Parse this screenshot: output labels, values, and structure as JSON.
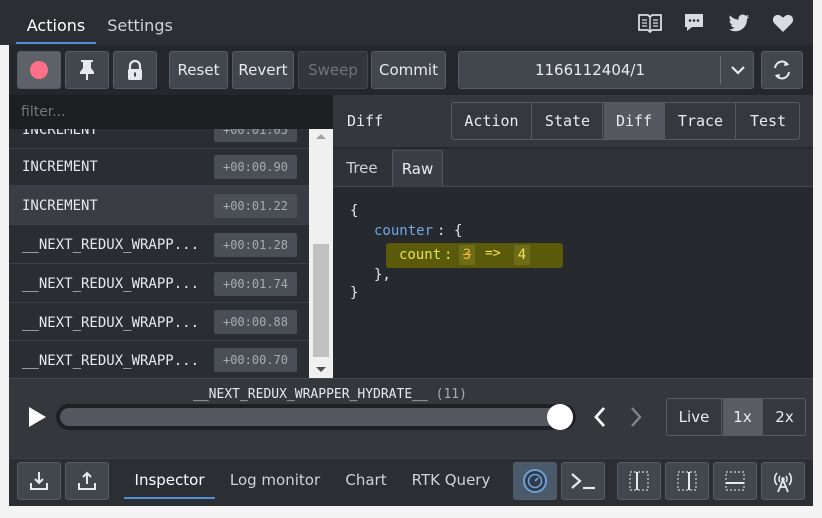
{
  "top_tabs": [
    "Actions",
    "Settings"
  ],
  "toolbar": {
    "reset": "Reset",
    "revert": "Revert",
    "sweep": "Sweep",
    "commit": "Commit",
    "instance": "1166112404/1"
  },
  "filter": {
    "placeholder": "filter..."
  },
  "actions": [
    {
      "name": "INCREMENT",
      "time": "+00:01:05"
    },
    {
      "name": "INCREMENT",
      "time": "+00:00.90"
    },
    {
      "name": "INCREMENT",
      "time": "+00:01.22"
    },
    {
      "name": "__NEXT_REDUX_WRAPP...",
      "time": "+00:01.28"
    },
    {
      "name": "__NEXT_REDUX_WRAPP...",
      "time": "+00:01.74"
    },
    {
      "name": "__NEXT_REDUX_WRAPP...",
      "time": "+00:00.88"
    },
    {
      "name": "__NEXT_REDUX_WRAPP...",
      "time": "+00:00.70"
    }
  ],
  "panel": {
    "title": "Diff",
    "tabs": [
      "Action",
      "State",
      "Diff",
      "Trace",
      "Test"
    ],
    "subtabs": [
      "Tree",
      "Raw"
    ]
  },
  "diff": {
    "open_brace": "{",
    "key": "counter",
    "colon": ":",
    "inner_open": "{",
    "field": "count",
    "old": "3",
    "arrow": "=>",
    "new": "4",
    "inner_close": "},",
    "close_brace": "}"
  },
  "slider": {
    "current_action": "__NEXT_REDUX_WRAPPER_HYDRATE__",
    "count": "(11)",
    "position": 1.0,
    "modes": [
      "Live",
      "1x",
      "2x"
    ]
  },
  "bottom_tabs": [
    "Inspector",
    "Log monitor",
    "Chart",
    "RTK Query"
  ],
  "colors": {
    "accent": "#4f8fd8",
    "record": "#ff6f85",
    "highlight": "#6b6b10",
    "panel_bg": "#2a2d32"
  }
}
